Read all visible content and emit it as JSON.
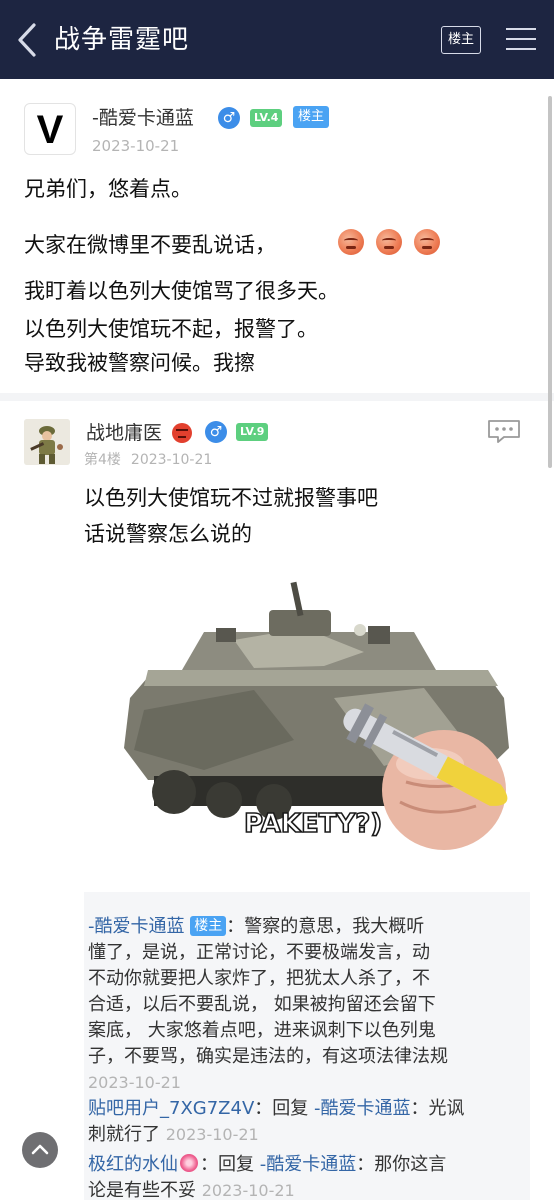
{
  "header": {
    "title": "战争雷霆吧",
    "host_only_label": "楼主",
    "back_icon": "chevron-left-icon",
    "menu_icon": "hamburger-menu-icon"
  },
  "post": {
    "avatar_letter": "V",
    "author": "-酷爱卡通蓝",
    "gender": "♂",
    "level": "LV.4",
    "host_badge": "楼主",
    "date": "2023-10-21",
    "lines": [
      "兄弟们，悠着点。",
      "大家在微博里不要乱说话，",
      "我盯着以色列大使馆骂了很多天。",
      "以色列大使馆玩不起，报警了。",
      "导致我被警察问候。我擦"
    ],
    "emoji": "angry-face-emoji"
  },
  "reply": {
    "author": "战地庸医",
    "gender": "♂",
    "level": "LV.9",
    "floor": "第4楼",
    "date": "2023-10-21",
    "lines": [
      "以色列大使馆玩不过就报警事吧",
      "话说警察怎么说的"
    ],
    "image_caption": "PAKETY?)",
    "comment_icon": "comment-icon"
  },
  "sub_replies": [
    {
      "name": "-酷爱卡通蓝",
      "badge": "楼主",
      "text_lines": [
        "：警察的意思，我大概听",
        "懂了，是说，正常讨论，不要极端发言，动",
        "不动你就要把人家炸了，把犹太人杀了，不",
        "合适，以后不要乱说， 如果被拘留还会留下",
        "案底， 大家悠着点吧，进来讽刺下以色列鬼",
        "子，不要骂，确实是违法的，有这项法律法规"
      ],
      "date": "2023-10-21"
    },
    {
      "name": "贴吧用户_7XG7Z4V",
      "reply_word": "回复",
      "target": "-酷爱卡通蓝",
      "text_a": "：光讽",
      "text_b": "刺就行了",
      "date": "2023-10-21"
    },
    {
      "name": "极红的水仙",
      "reply_word": "回复",
      "target": "-酷爱卡通蓝",
      "text_a": "：那你这言",
      "text_b": "论是有些不妥",
      "date": "2023-10-21"
    }
  ],
  "colors": {
    "header_bg": "#1d2541",
    "level_badge": "#5dcf7f",
    "host_badge": "#4aa3f3",
    "link_name": "#3466a6"
  }
}
